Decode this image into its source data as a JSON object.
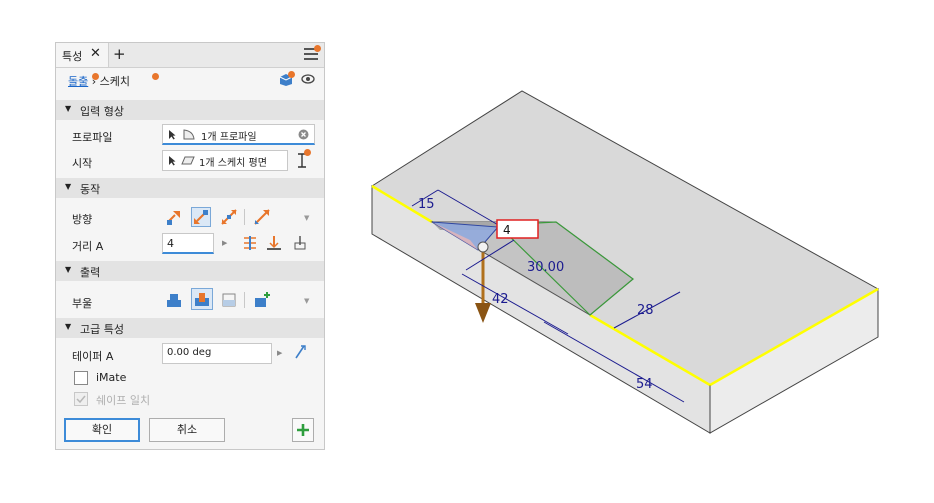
{
  "panel": {
    "tab_label": "특성",
    "close_glyph": "✕",
    "add_glyph": "+",
    "breadcrumb": {
      "link": "돌출",
      "separator": "›",
      "current": "스케치"
    },
    "sections": {
      "input": {
        "title": "입력 형상",
        "profile_label": "프로파일",
        "profile_value": "1개 프로파일",
        "start_label": "시작",
        "start_value": "1개 스케치 평면"
      },
      "behavior": {
        "title": "동작",
        "direction_label": "방향",
        "distance_label": "거리 A",
        "distance_value": "4"
      },
      "output": {
        "title": "출력",
        "boolean_label": "부울"
      },
      "advanced": {
        "title": "고급 특성",
        "taper_label": "테이퍼 A",
        "taper_value": "0.00 deg",
        "imate_label": "iMate",
        "match_shape_label": "쉐이프 일치"
      }
    },
    "ok_label": "확인",
    "cancel_label": "취소"
  },
  "viewport": {
    "dimensions": {
      "d15": "15",
      "d30": "30.00",
      "d42": "42",
      "d28": "28",
      "d54": "54"
    },
    "edit_box_value": "4"
  },
  "colors": {
    "accent": "#3d8bd8",
    "notification": "#e8762c",
    "dimension": "#1b1b8f",
    "highlight_edge": "#ffff00",
    "direction_arrow": "#b0701c"
  },
  "icons": [
    "close-icon",
    "add-tab-icon",
    "hamburger-menu-icon",
    "cube-icon",
    "eye-icon",
    "cursor-icon",
    "profile-icon",
    "plane-icon",
    "clear-icon",
    "origin-icon",
    "direction-default-icon",
    "direction-flipped-icon",
    "direction-symmetric-icon",
    "direction-asymmetric-icon",
    "extents-distance-icon",
    "extents-to-icon",
    "extents-through-all-icon",
    "join-icon",
    "cut-icon",
    "intersect-icon",
    "new-solid-icon",
    "taper-flip-icon",
    "add-icon"
  ]
}
